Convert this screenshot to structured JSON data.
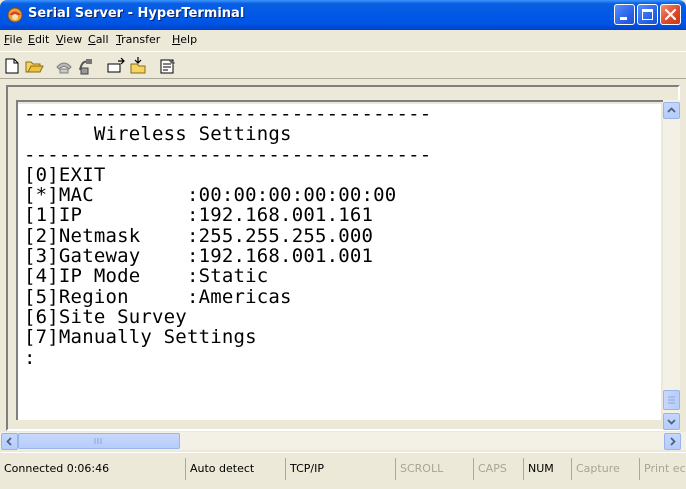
{
  "window": {
    "title": "Serial Server - HyperTerminal"
  },
  "menu": {
    "items": [
      {
        "label": "File",
        "accel": "F",
        "rest": "ile"
      },
      {
        "label": "Edit",
        "accel": "E",
        "rest": "dit"
      },
      {
        "label": "View",
        "accel": "V",
        "rest": "iew"
      },
      {
        "label": "Call",
        "accel": "C",
        "rest": "all"
      },
      {
        "label": "Transfer",
        "accel": "T",
        "rest": "ransfer"
      },
      {
        "label": "Help",
        "accel": "H",
        "rest": "elp"
      }
    ]
  },
  "toolbar": {
    "buttons": [
      "new-icon",
      "open-icon",
      "connect-icon",
      "disconnect-icon",
      "send-icon",
      "receive-icon",
      "properties-icon"
    ]
  },
  "terminal": {
    "lines": [
      "-----------------------------------",
      "      Wireless Settings",
      "-----------------------------------",
      "[0]EXIT",
      "[*]MAC        :00:00:00:00:00:00",
      "[1]IP         :192.168.001.161",
      "[2]Netmask    :255.255.255.000",
      "[3]Gateway    :192.168.001.001",
      "[4]IP Mode    :Static",
      "[5]Region     :Americas",
      "[6]Site Survey",
      "[7]Manually Settings",
      ":"
    ]
  },
  "statusbar": {
    "connected": "Connected 0:06:46",
    "detect": "Auto detect",
    "protocol": "TCP/IP",
    "scroll": "SCROLL",
    "caps": "CAPS",
    "num": "NUM",
    "capture": "Capture",
    "print": "Print echo"
  },
  "colors": {
    "titlebar": "#0054e3",
    "close_button": "#e0482a",
    "window_bg": "#ece9d8",
    "terminal_bg": "#ffffff"
  }
}
